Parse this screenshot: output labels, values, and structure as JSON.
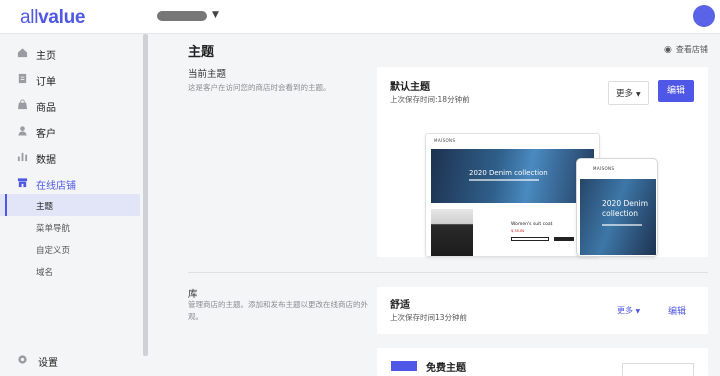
{
  "header": {
    "logo": "allvalue",
    "logo_color": "#4f58e6"
  },
  "sidebar": {
    "items": [
      {
        "label": "主页",
        "icon": "home-icon"
      },
      {
        "label": "订单",
        "icon": "order-icon"
      },
      {
        "label": "商品",
        "icon": "bag-icon"
      },
      {
        "label": "客户",
        "icon": "user-icon"
      },
      {
        "label": "数据",
        "icon": "chart-icon"
      },
      {
        "label": "在线店铺",
        "icon": "store-icon"
      }
    ],
    "sub_items": [
      {
        "label": "主题"
      },
      {
        "label": "菜单导航"
      },
      {
        "label": "自定义页"
      },
      {
        "label": "域名"
      }
    ],
    "settings_label": "设置"
  },
  "main": {
    "title": "主题",
    "view_store": "查看店铺",
    "current": {
      "title": "当前主题",
      "desc": "这是客户在访问您的商店时会看到的主题。",
      "theme_name": "默认主题",
      "saved": "上次保存时间:18分钟前",
      "more": "更多",
      "edit": "编辑",
      "preview": {
        "hero_text": "2020 Denim collection",
        "product_title": "Women's suit coat",
        "price": "$ 35.00",
        "phone_text": "2020 Denim collection"
      }
    },
    "library": {
      "title": "库",
      "desc": "管理商店的主题。添加和发布主题以更改在线商店的外观。",
      "theme_name": "舒适",
      "saved": "上次保存时间13分钟前",
      "more": "更多",
      "edit": "编辑"
    },
    "free": {
      "title": "免费主题"
    }
  }
}
